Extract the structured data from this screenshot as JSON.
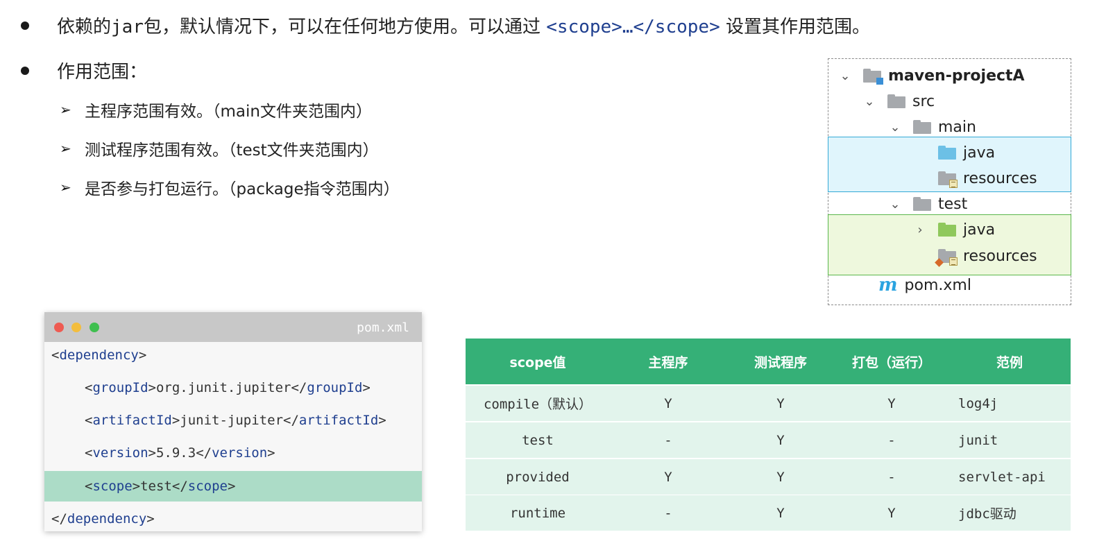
{
  "bullets": {
    "first": {
      "text_a": "依赖的",
      "text_jar": "jar",
      "text_b": "包，默认情况下，可以在任何地方使用。可以通过",
      "code": "<scope>…</scope>",
      "text_c": "设置其作用范围。"
    },
    "second": {
      "text": "作用范围："
    }
  },
  "sub_items": [
    {
      "text": "主程序范围有效。（main文件夹范围内）"
    },
    {
      "text": "测试程序范围有效。（test文件夹范围内）"
    },
    {
      "text": "是否参与打包运行。（package指令范围内）"
    }
  ],
  "tree": {
    "project": "maven-projectA",
    "src": "src",
    "main": "main",
    "main_java": "java",
    "main_resources": "resources",
    "test": "test",
    "test_java": "java",
    "test_resources": "resources",
    "pom": "pom.xml",
    "pom_icon": "m",
    "highlight_colors": {
      "main": "#e0f5fc",
      "test": "#eef8dd"
    }
  },
  "code_window": {
    "title": "pom.xml",
    "traffic_lights": [
      "#ee5b52",
      "#f3bd3d",
      "#3fbf4f"
    ],
    "lines": [
      {
        "open": "<",
        "tag": "dependency",
        "close": ">",
        "content": "",
        "end_open": "",
        "end_tag": "",
        "end_close": ""
      },
      {
        "open": "<",
        "tag": "groupId",
        "close": ">",
        "content": "org.junit.jupiter",
        "end_open": "</",
        "end_tag": "groupId",
        "end_close": ">"
      },
      {
        "open": "<",
        "tag": "artifactId",
        "close": ">",
        "content": "junit-jupiter",
        "end_open": "</",
        "end_tag": "artifactId",
        "end_close": ">"
      },
      {
        "open": "<",
        "tag": "version",
        "close": ">",
        "content": "5.9.3",
        "end_open": "</",
        "end_tag": "version",
        "end_close": ">"
      },
      {
        "open": "<",
        "tag": "scope",
        "close": ">",
        "content": "test",
        "end_open": "</",
        "end_tag": "scope",
        "end_close": ">"
      },
      {
        "open": "</",
        "tag": "dependency",
        "close": ">",
        "content": "",
        "end_open": "",
        "end_tag": "",
        "end_close": ""
      }
    ],
    "highlight_color": "#acdcc7"
  },
  "scope_table": {
    "header_color": "#35b077",
    "row_color": "#e2f4ec",
    "headers": [
      "scope值",
      "主程序",
      "测试程序",
      "打包（运行）",
      "范例"
    ],
    "rows": [
      [
        "compile（默认）",
        "Y",
        "Y",
        "Y",
        "log4j"
      ],
      [
        "test",
        "-",
        "Y",
        "-",
        "junit"
      ],
      [
        "provided",
        "Y",
        "Y",
        "-",
        "servlet-api"
      ],
      [
        "runtime",
        "-",
        "Y",
        "Y",
        "jdbc驱动"
      ]
    ]
  }
}
